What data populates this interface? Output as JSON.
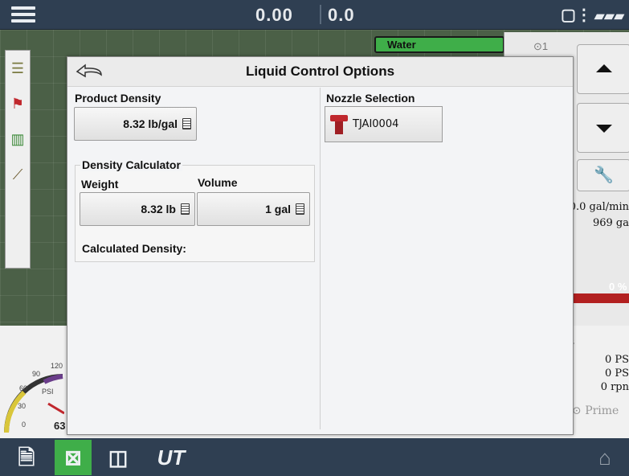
{
  "topbar": {
    "value_left": "0.00",
    "value_right": "0.0",
    "menu_icon": "hamburger-icon",
    "right_icons": [
      "display-config-icon",
      "signal-icon"
    ]
  },
  "map": {
    "product_tab_label": "Water",
    "indicator_label": "⊙1",
    "rate_text": "0.0 gal/min",
    "volume_text": "969 ga",
    "bar_percent_text": "0 %",
    "readouts": [
      "0 PS",
      "0 PS",
      "0 rpn"
    ],
    "readouts_header": "s",
    "prime_label": "Prime",
    "gauge": {
      "ticks": [
        "90",
        "120",
        "60",
        "30",
        "0"
      ],
      "unit": "PSI",
      "value_text": "63"
    }
  },
  "dialog": {
    "title": "Liquid Control Options",
    "product_density": {
      "label": "Product Density",
      "value": "8.32 lb/gal"
    },
    "density_calculator": {
      "label": "Density Calculator",
      "weight_label": "Weight",
      "weight_value": "8.32 lb",
      "volume_label": "Volume",
      "volume_value": "1 gal",
      "calculated_label": "Calculated Density:"
    },
    "nozzle_selection": {
      "label": "Nozzle Selection",
      "nozzle_name": "TJAI0004"
    }
  },
  "bottombar": {
    "ut_label": "UT"
  },
  "colors": {
    "bar_bg": "#2f3f52",
    "accent_green": "#3fae49",
    "alert_red": "#b22020"
  }
}
